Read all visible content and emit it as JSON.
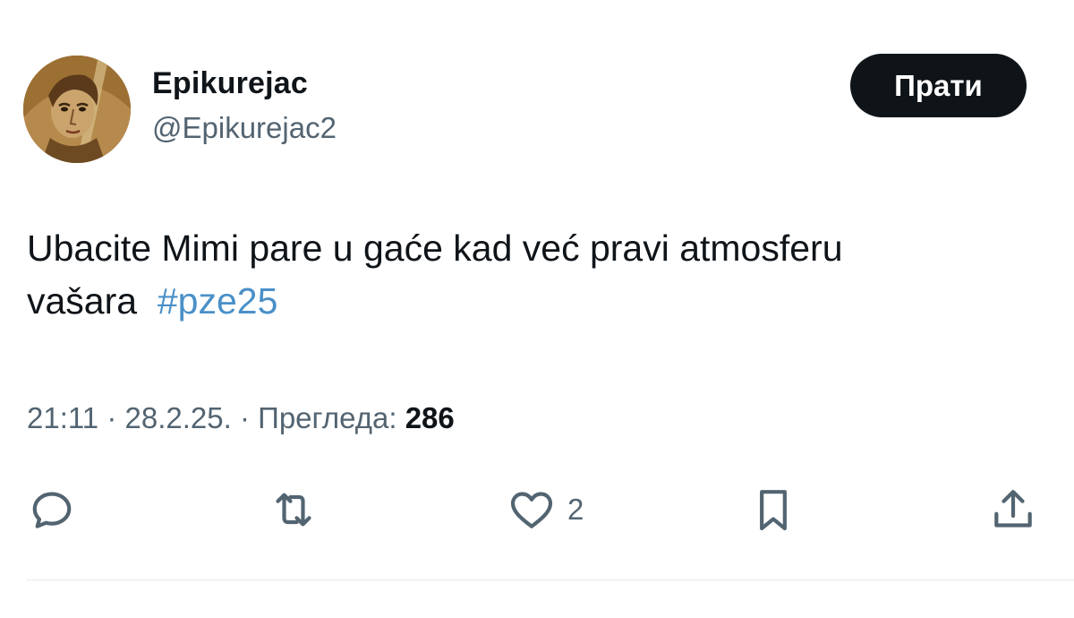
{
  "user": {
    "display_name": "Epikurejac",
    "handle": "@Epikurejac2"
  },
  "follow_button": {
    "label": "Прати"
  },
  "tweet": {
    "text_line1": "Ubacite Mimi pare u gaće kad već pravi atmosferu",
    "text_line2": "vašara",
    "hashtag": "#pze25"
  },
  "meta": {
    "time": "21:11",
    "date": "28.2.25.",
    "views_label": "Прегледа:",
    "views_count": "286"
  },
  "actions": {
    "reply": {
      "icon": "reply-icon"
    },
    "retweet": {
      "icon": "retweet-icon"
    },
    "like": {
      "icon": "heart-icon",
      "count": "2"
    },
    "bookmark": {
      "icon": "bookmark-icon"
    },
    "share": {
      "icon": "share-icon"
    }
  },
  "colors": {
    "text": "#0f1419",
    "secondary": "#536471",
    "hashtag": "#4a90c8",
    "button_bg": "#0f1419"
  }
}
